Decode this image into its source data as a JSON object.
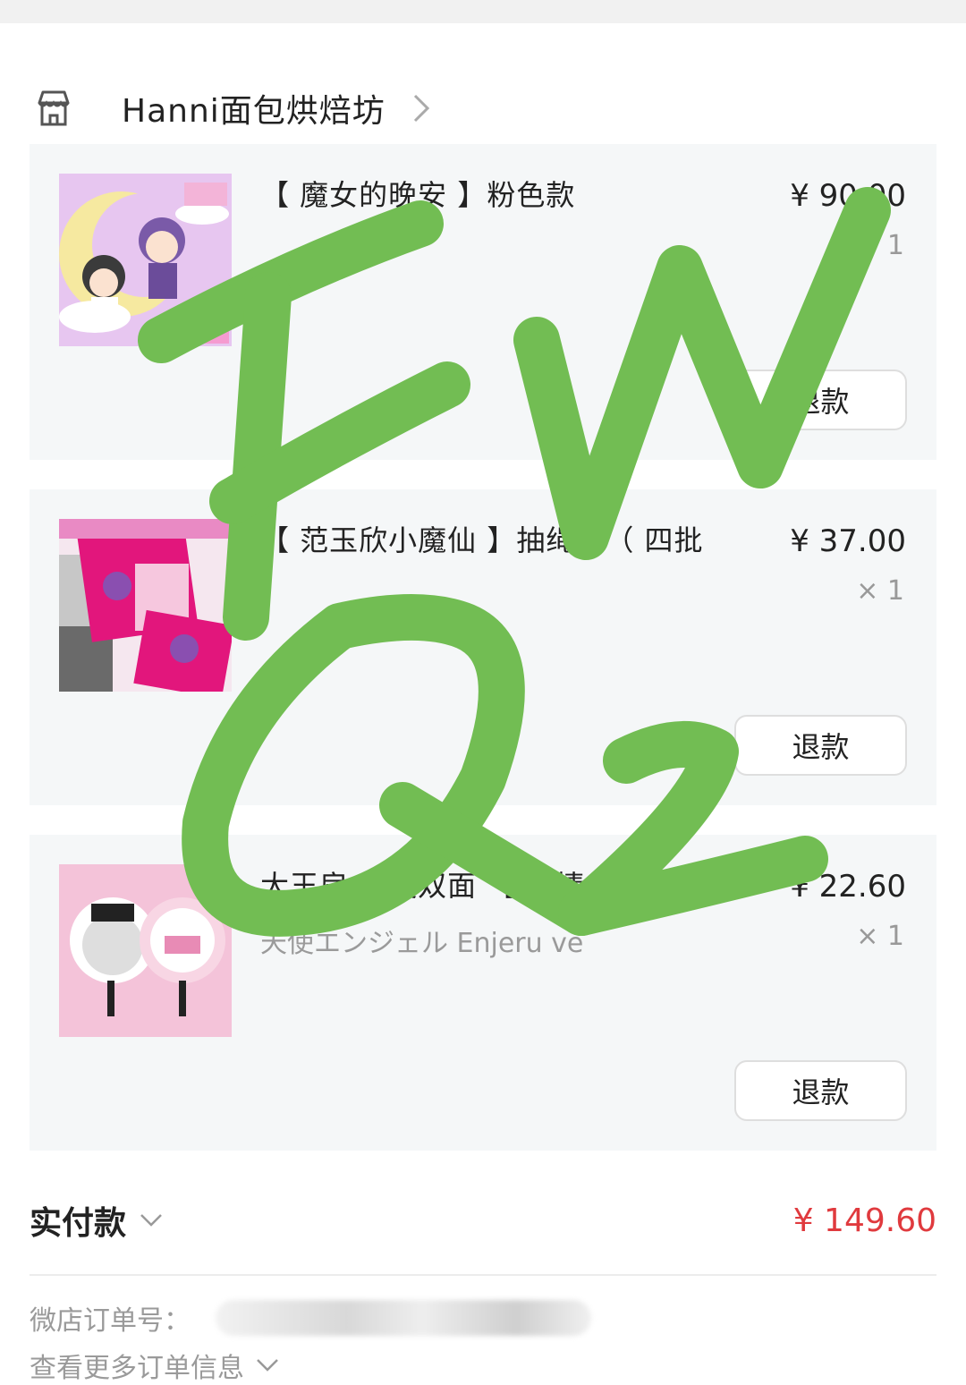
{
  "shop": {
    "name": "Hanni面包烘焙坊",
    "icon": "store-icon"
  },
  "items": [
    {
      "title": "【 魔女的晚安 】粉色款",
      "subtitle": "",
      "price": "¥ 90.00",
      "quantity": "× 1",
      "refund_label": "退款"
    },
    {
      "title": "【 范玉欣小魔仙 】抽绳包（ 四批",
      "subtitle": "",
      "price": "¥ 37.00",
      "quantity": "× 1",
      "refund_label": "退款"
    },
    {
      "title": "大王扇 天使双面 【 详情",
      "subtitle": "天使エンジェル Enjeru ve",
      "price": "¥ 22.60",
      "quantity": "× 1",
      "refund_label": "退款"
    }
  ],
  "summary": {
    "paid_label": "实付款",
    "paid_value": "¥ 149.60",
    "order_no_label": "微店订单号：",
    "more_info_label": "查看更多订单信息"
  },
  "colors": {
    "accent_price": "#e03a3e",
    "scribble": "#72bd53",
    "item_bg": "#f5f7f8"
  }
}
